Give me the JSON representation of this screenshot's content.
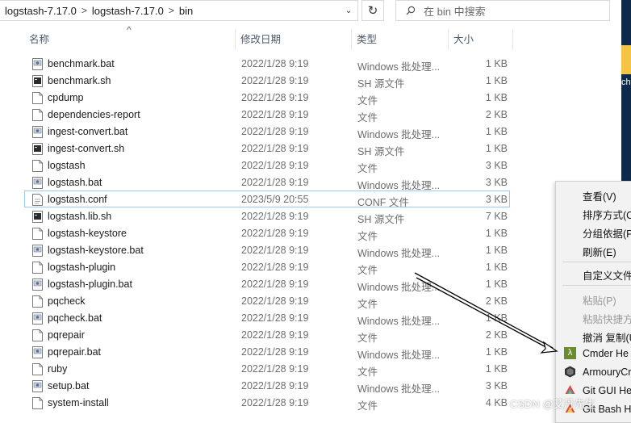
{
  "address": {
    "crumbs": [
      "logstash-7.17.0",
      "logstash-7.17.0",
      "bin"
    ],
    "separator": ">"
  },
  "search": {
    "placeholder": "在 bin 中搜索"
  },
  "columns": {
    "name": "名称",
    "date": "修改日期",
    "type": "类型",
    "size": "大小"
  },
  "files": [
    {
      "name": "benchmark.bat",
      "date": "2022/1/28 9:19",
      "type": "Windows 批处理...",
      "size": "1 KB",
      "icon": "batch-file-icon"
    },
    {
      "name": "benchmark.sh",
      "date": "2022/1/28 9:19",
      "type": "SH 源文件",
      "size": "1 KB",
      "icon": "shell-file-icon"
    },
    {
      "name": "cpdump",
      "date": "2022/1/28 9:19",
      "type": "文件",
      "size": "1 KB",
      "icon": "file-icon"
    },
    {
      "name": "dependencies-report",
      "date": "2022/1/28 9:19",
      "type": "文件",
      "size": "2 KB",
      "icon": "file-icon"
    },
    {
      "name": "ingest-convert.bat",
      "date": "2022/1/28 9:19",
      "type": "Windows 批处理...",
      "size": "1 KB",
      "icon": "batch-file-icon"
    },
    {
      "name": "ingest-convert.sh",
      "date": "2022/1/28 9:19",
      "type": "SH 源文件",
      "size": "1 KB",
      "icon": "shell-file-icon"
    },
    {
      "name": "logstash",
      "date": "2022/1/28 9:19",
      "type": "文件",
      "size": "3 KB",
      "icon": "file-icon"
    },
    {
      "name": "logstash.bat",
      "date": "2022/1/28 9:19",
      "type": "Windows 批处理...",
      "size": "3 KB",
      "icon": "batch-file-icon"
    },
    {
      "name": "logstash.conf",
      "date": "2023/5/9 20:55",
      "type": "CONF 文件",
      "size": "3 KB",
      "icon": "conf-file-icon"
    },
    {
      "name": "logstash.lib.sh",
      "date": "2022/1/28 9:19",
      "type": "SH 源文件",
      "size": "7 KB",
      "icon": "shell-file-icon"
    },
    {
      "name": "logstash-keystore",
      "date": "2022/1/28 9:19",
      "type": "文件",
      "size": "1 KB",
      "icon": "file-icon"
    },
    {
      "name": "logstash-keystore.bat",
      "date": "2022/1/28 9:19",
      "type": "Windows 批处理...",
      "size": "1 KB",
      "icon": "batch-file-icon"
    },
    {
      "name": "logstash-plugin",
      "date": "2022/1/28 9:19",
      "type": "文件",
      "size": "1 KB",
      "icon": "file-icon"
    },
    {
      "name": "logstash-plugin.bat",
      "date": "2022/1/28 9:19",
      "type": "Windows 批处理...",
      "size": "1 KB",
      "icon": "batch-file-icon"
    },
    {
      "name": "pqcheck",
      "date": "2022/1/28 9:19",
      "type": "文件",
      "size": "2 KB",
      "icon": "file-icon"
    },
    {
      "name": "pqcheck.bat",
      "date": "2022/1/28 9:19",
      "type": "Windows 批处理...",
      "size": "1 KB",
      "icon": "batch-file-icon"
    },
    {
      "name": "pqrepair",
      "date": "2022/1/28 9:19",
      "type": "文件",
      "size": "2 KB",
      "icon": "file-icon"
    },
    {
      "name": "pqrepair.bat",
      "date": "2022/1/28 9:19",
      "type": "Windows 批处理...",
      "size": "1 KB",
      "icon": "batch-file-icon"
    },
    {
      "name": "ruby",
      "date": "2022/1/28 9:19",
      "type": "文件",
      "size": "1 KB",
      "icon": "file-icon"
    },
    {
      "name": "setup.bat",
      "date": "2022/1/28 9:19",
      "type": "Windows 批处理...",
      "size": "3 KB",
      "icon": "batch-file-icon"
    },
    {
      "name": "system-install",
      "date": "2022/1/28 9:19",
      "type": "文件",
      "size": "4 KB",
      "icon": "file-icon"
    }
  ],
  "selected_file": "logstash.conf",
  "context_menu": {
    "view": "查看(V)",
    "sort": "排序方式(O",
    "group": "分组依据(P)",
    "refresh": "刷新(E)",
    "customize": "自定义文件",
    "paste": "粘贴(P)",
    "paste_shortcut": "粘贴快捷方",
    "undo": "撤消 复制(U",
    "cmder": "Cmder He",
    "armoury": "ArmouryCr",
    "git_gui": "Git GUI He",
    "git_bash": "Git Bash H"
  },
  "desktop_label": "ch",
  "watermark": "CSDN @艾丹先生",
  "colors": {
    "selection_border": "#99c9ef",
    "header_text": "#4a5a6e",
    "menu_bg": "#f2f2f2"
  }
}
